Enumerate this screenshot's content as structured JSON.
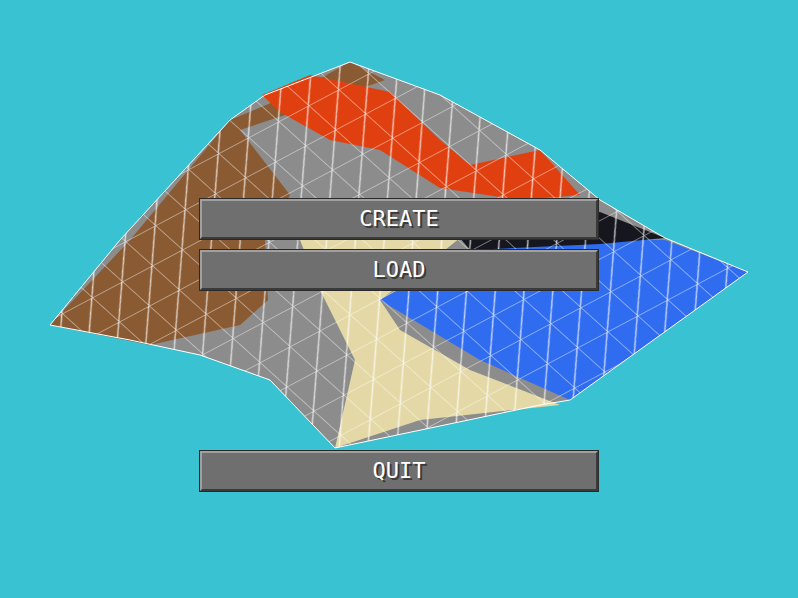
{
  "screen": "main-menu",
  "buttons": [
    {
      "label": "CREATE"
    },
    {
      "label": "LOAD"
    },
    {
      "label": "QUIT"
    }
  ]
}
